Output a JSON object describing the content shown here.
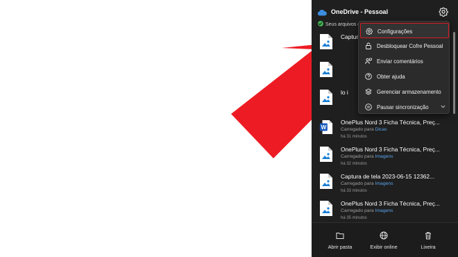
{
  "panel": {
    "app_name": "OneDrive",
    "account_label": "- Pessoal",
    "status_text": "Seus arquivos e",
    "icons": {
      "cloud": "onedrive-cloud-icon",
      "settings": "gear-icon",
      "status": "check-circle-icon"
    }
  },
  "files": [
    {
      "name": "Captura",
      "location_prefix": "",
      "folder": "",
      "time": "",
      "icon": "image-file-icon"
    },
    {
      "name": "",
      "location_prefix": "",
      "folder": "",
      "time": "",
      "icon": "image-file-icon"
    },
    {
      "name": "lo i",
      "location_prefix": "",
      "folder": "",
      "time": "",
      "icon": "image-file-icon"
    },
    {
      "name": "OnePlus Nord 3 Ficha Técnica, Preç...",
      "location_prefix": "Carregado para",
      "folder": "Dicas",
      "time": "há 31 minutos",
      "icon": "word-file-icon"
    },
    {
      "name": "OnePlus Nord 3 Ficha Técnica, Preç...",
      "location_prefix": "Carregado para",
      "folder": "Imagens",
      "time": "há 32 minutos",
      "icon": "image-file-icon"
    },
    {
      "name": "Captura de tela 2023-06-15 12362...",
      "location_prefix": "Carregado para",
      "folder": "Imagens",
      "time": "há 33 minutos",
      "icon": "image-file-icon"
    },
    {
      "name": "OnePlus Nord 3 Ficha Técnica, Preç...",
      "location_prefix": "Carregado para",
      "folder": "Imagens",
      "time": "há 35 minutos",
      "icon": "image-file-icon"
    }
  ],
  "menu": {
    "items": [
      {
        "label": "Configurações",
        "icon": "gear-icon",
        "selected": true
      },
      {
        "label": "Desbloquear Cofre Pessoal",
        "icon": "lock-icon"
      },
      {
        "label": "Enviar comentários",
        "icon": "feedback-icon"
      },
      {
        "label": "Obter ajuda",
        "icon": "help-icon"
      },
      {
        "label": "Gerenciar armazenamento",
        "icon": "storage-icon"
      },
      {
        "label": "Pausar sincronização",
        "icon": "pause-icon",
        "chevron": "chevron-down-icon"
      }
    ]
  },
  "footer": {
    "open_folder": "Abrir pasta",
    "view_online": "Exibir online",
    "recycle_bin": "Lixeira",
    "icons": {
      "open_folder": "folder-icon",
      "view_online": "globe-icon",
      "recycle_bin": "trash-icon"
    }
  },
  "colors": {
    "panel_bg": "#1f1f1f",
    "accent_blue": "#5aa7f0",
    "annotation_red": "#ed1c24",
    "selection_border": "#d91b24"
  },
  "annotation": {
    "type": "arrow",
    "color": "#ed1c24",
    "points_to": "Configurações"
  }
}
